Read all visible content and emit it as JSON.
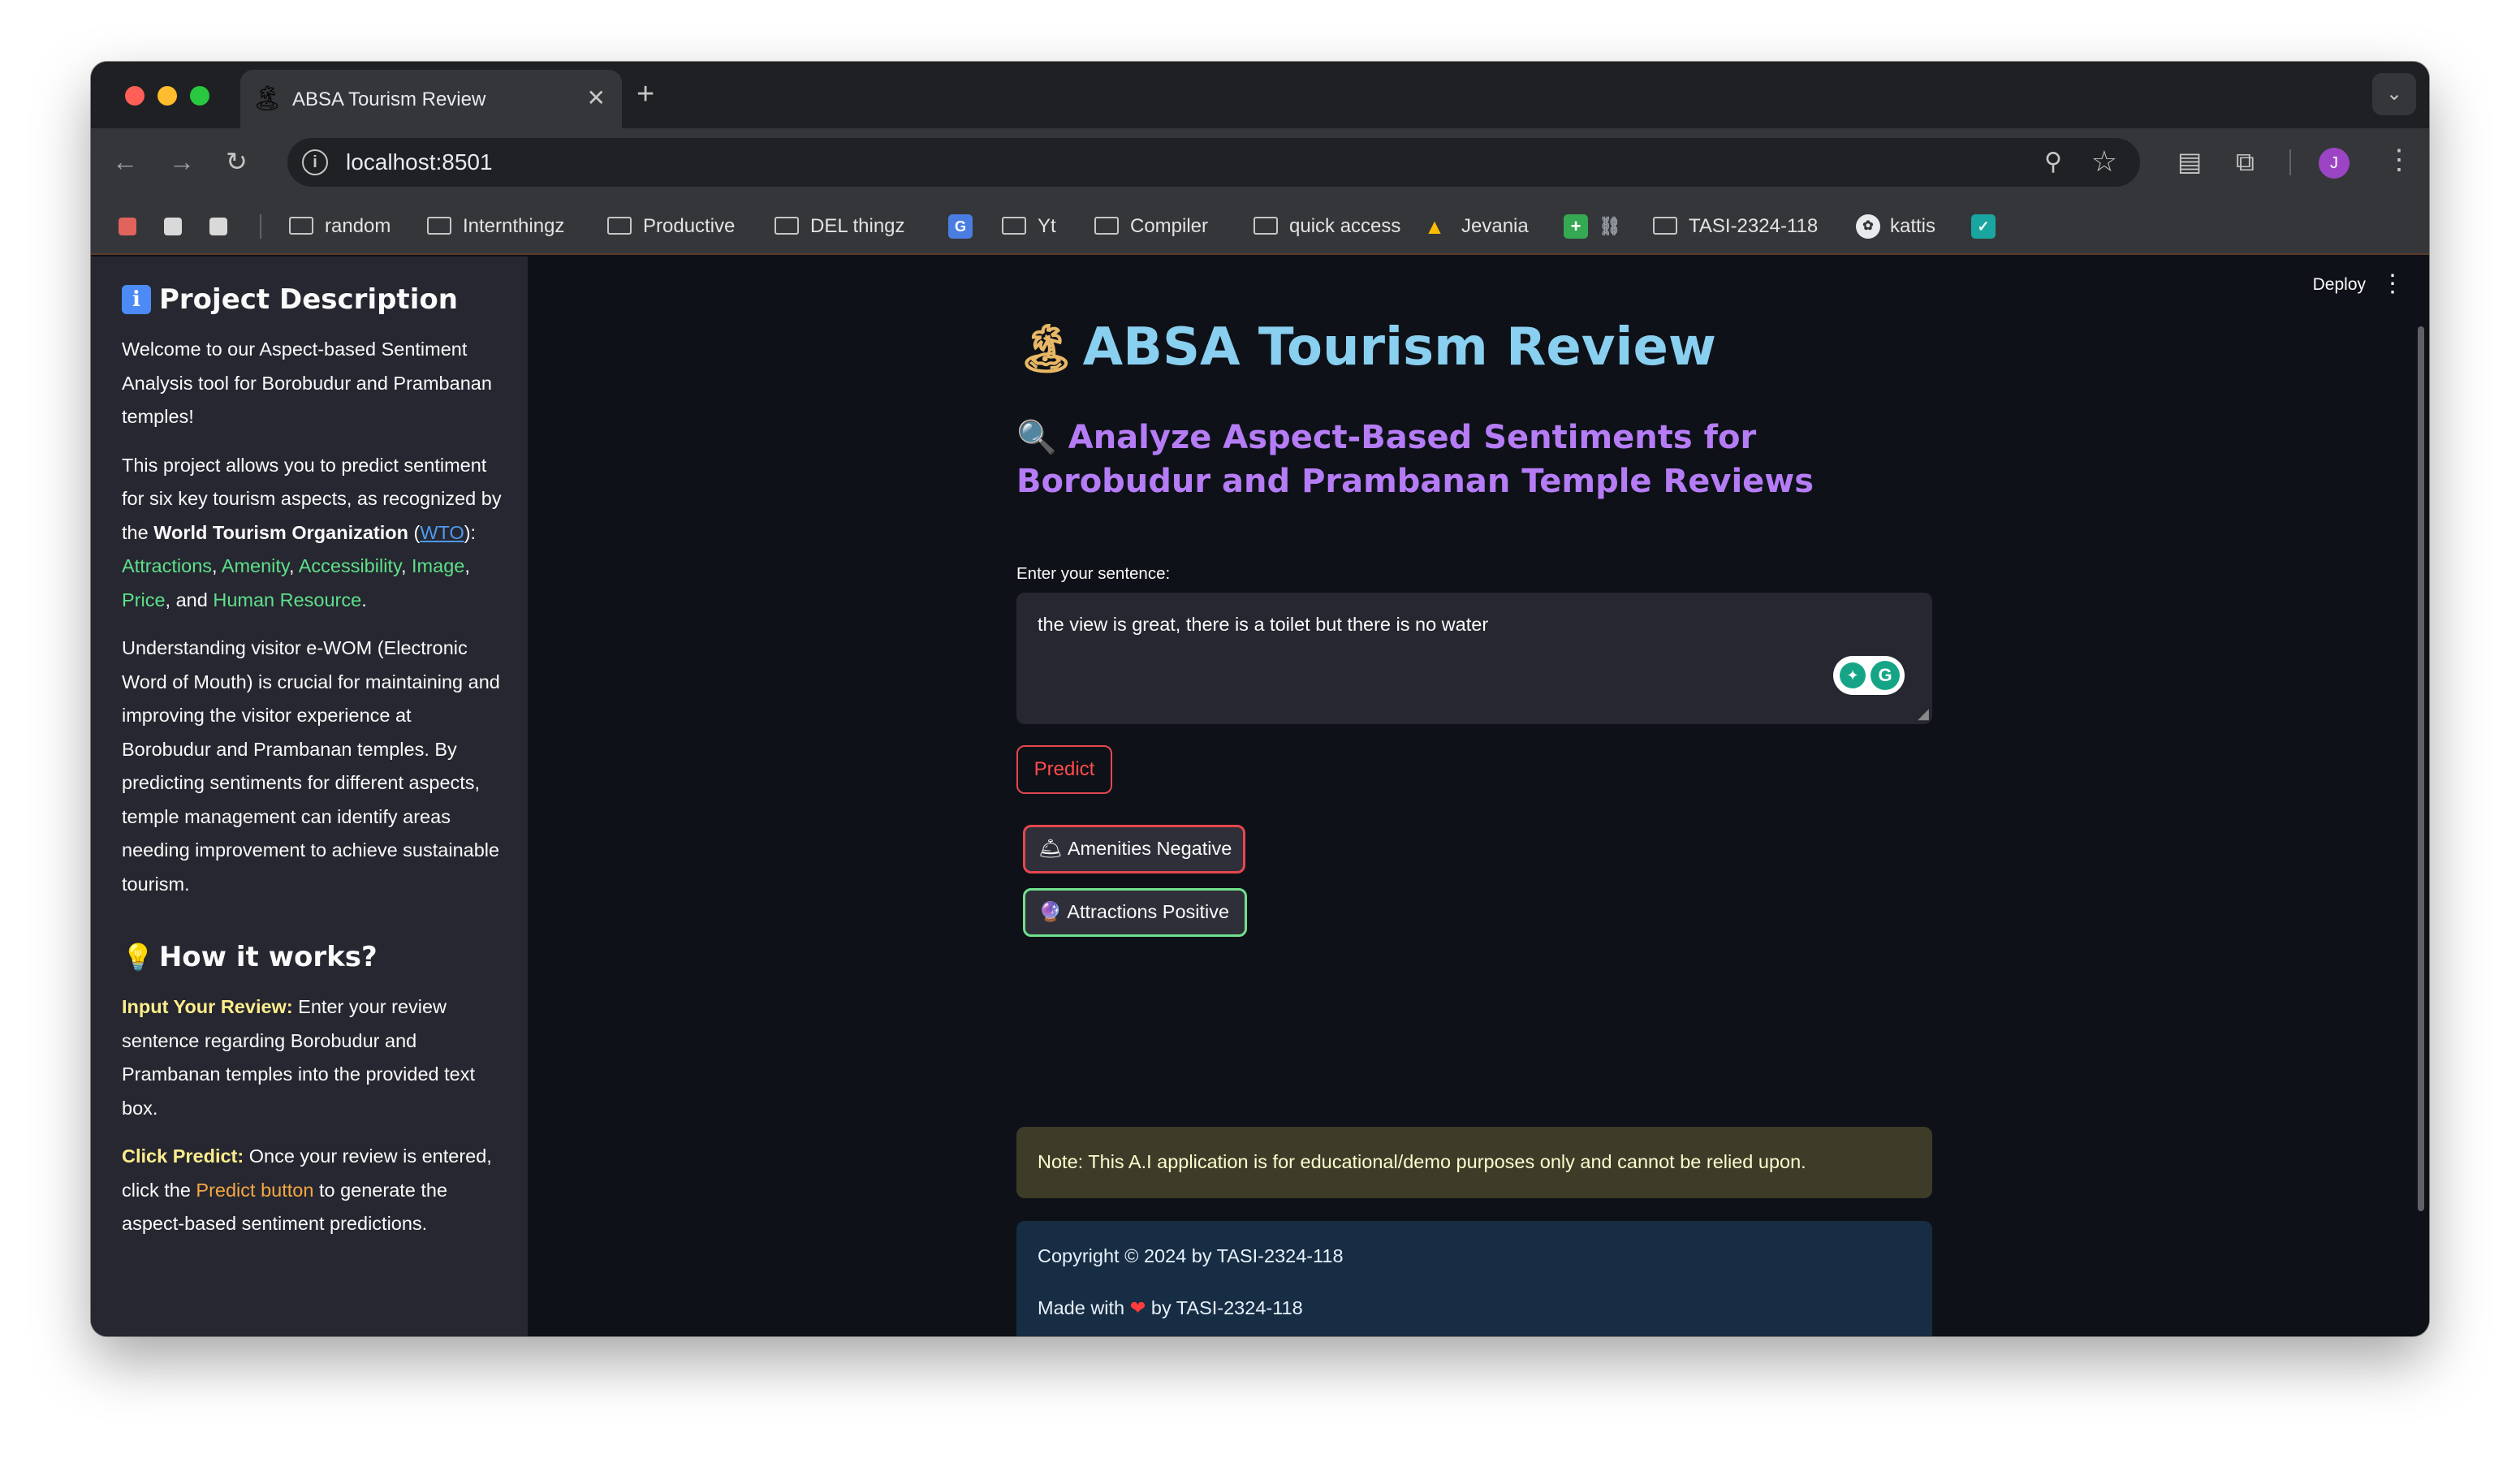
{
  "browser": {
    "tab": {
      "favicon": "island-emoji",
      "title": "ABSA Tourism Review",
      "close": "✕"
    },
    "new_tab": "+",
    "tab_list": "⌄",
    "url": "localhost:8501",
    "avatar_letter": "J"
  },
  "bookmarks": [
    "random",
    "Internthingz",
    "Productive",
    "DEL thingz",
    "Yt",
    "Compiler",
    "quick access",
    "Jevania",
    "TASI-2324-118",
    "kattis"
  ],
  "header": {
    "deploy": "Deploy"
  },
  "sidebar": {
    "project_heading": "Project Description",
    "intro": "Welcome to our Aspect-based Sentiment Analysis tool for Borobudur and Prambanan temples!",
    "p2_start": "This project allows you to predict sentiment for six key tourism aspects, as recognized by the ",
    "wto_org": "World Tourism Organization",
    "wto": "WTO",
    "aspects": [
      "Attractions",
      "Amenity",
      "Accessibility",
      "Image",
      "Price",
      "Human Resource"
    ],
    "p3": "Understanding visitor e-WOM (Electronic Word of Mouth) is crucial for maintaining and improving the visitor experience at Borobudur and Prambanan temples. By predicting sentiments for different aspects, temple management can identify areas needing improvement to achieve sustainable tourism.",
    "how_heading": "How it works?",
    "step1_label": "Input Your Review:",
    "step1_text": " Enter your review sentence regarding Borobudur and Prambanan temples into the provided text box.",
    "step2_label": "Click Predict:",
    "step2_text_a": " Once your review is entered, click the ",
    "step2_link": "Predict button",
    "step2_text_b": " to generate the aspect-based sentiment predictions."
  },
  "main": {
    "title": "ABSA Tourism Review",
    "subtitle": "Analyze Aspect-Based Sentiments for Borobudur and Prambanan Temple Reviews",
    "input_label": "Enter your sentence:",
    "input_value": "the view is great, there is a toilet but there is no water",
    "predict_label": "Predict",
    "results": [
      {
        "label": "Amenities Negative",
        "sentiment": "negative",
        "color": "#e5474f"
      },
      {
        "label": "Attractions Positive",
        "sentiment": "positive",
        "color": "#6fe08d"
      }
    ],
    "note": "Note: This A.I application is for educational/demo purposes only and cannot be relied upon.",
    "copyright": "Copyright © 2024 by TASI-2324-118",
    "made_with_a": "Made with ",
    "made_with_b": " by TASI-2324-118"
  },
  "colors": {
    "title": "#89cff0",
    "subtitle": "#b57cf6",
    "accent_red": "#ff4b4b",
    "sidebar_bg": "#262730",
    "page_bg": "#0e1117"
  }
}
